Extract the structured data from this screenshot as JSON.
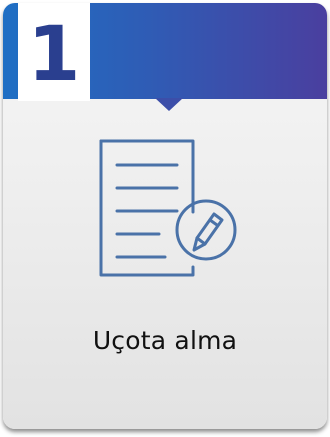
{
  "step": {
    "number": "1",
    "label": "Uçota alma"
  },
  "icon": {
    "name": "document-edit-icon",
    "color": "#4a72a8"
  },
  "colors": {
    "header_gradient_start": "#1f6fc4",
    "header_gradient_end": "#4a3f9f",
    "number_color": "#2a3f8f"
  }
}
